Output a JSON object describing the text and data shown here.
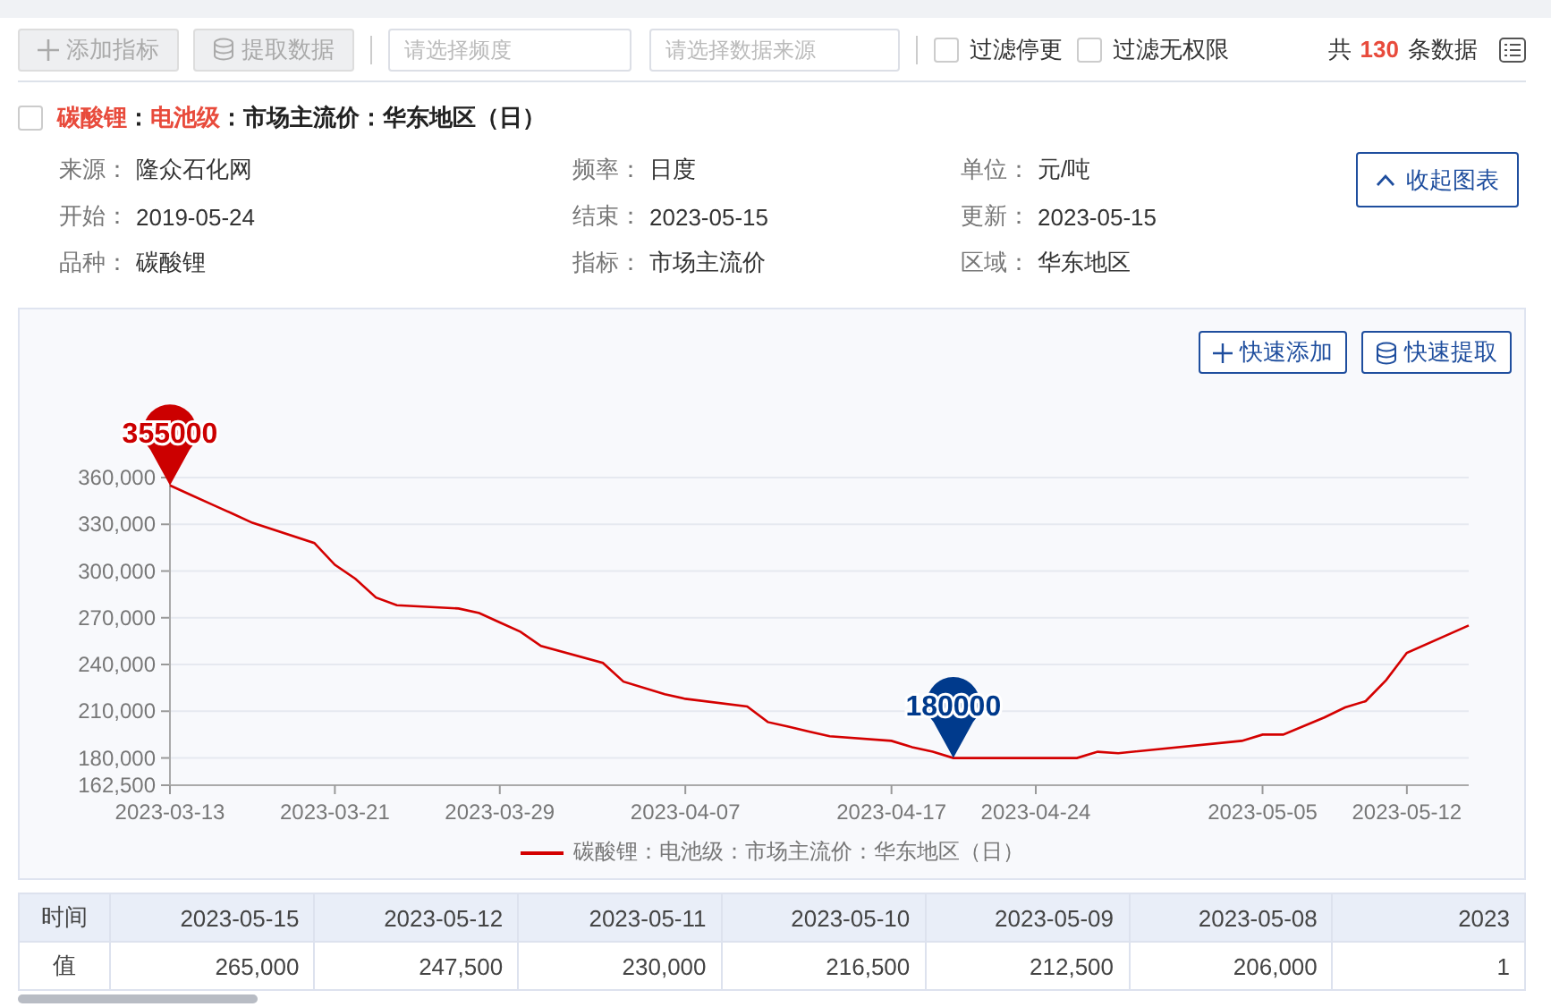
{
  "toolbar": {
    "buttons": [
      {
        "kind": "add",
        "label": "添加指标",
        "disabled": true
      },
      {
        "kind": "extract",
        "label": "提取数据",
        "disabled": true
      }
    ],
    "selects": [
      {
        "placeholder": "请选择频度"
      },
      {
        "placeholder": "请选择数据来源"
      }
    ],
    "filters": [
      {
        "label": "过滤停更",
        "checked": false
      },
      {
        "label": "过滤无权限",
        "checked": false
      }
    ],
    "count": {
      "prefix": "共",
      "value": "130",
      "suffix": "条数据"
    }
  },
  "indicator": {
    "checked": false,
    "title_parts": [
      {
        "text": "碳酸锂",
        "highlight": true
      },
      {
        "text": "：",
        "highlight": false
      },
      {
        "text": "电池级",
        "highlight": true
      },
      {
        "text": "：市场主流价：华东地区（日）",
        "highlight": false
      }
    ],
    "info": [
      {
        "label": "来源：",
        "value": "隆众石化网"
      },
      {
        "label": "频率：",
        "value": "日度"
      },
      {
        "label": "单位：",
        "value": "元/吨"
      },
      {
        "label": "开始：",
        "value": "2019-05-24"
      },
      {
        "label": "结束：",
        "value": "2023-05-15"
      },
      {
        "label": "更新：",
        "value": "2023-05-15"
      },
      {
        "label": "品种：",
        "value": "碳酸锂"
      },
      {
        "label": "指标：",
        "value": "市场主流价"
      },
      {
        "label": "区域：",
        "value": "华东地区"
      }
    ],
    "collapse_button": "收起图表"
  },
  "chart": {
    "buttons": [
      {
        "kind": "add",
        "label": "快速添加"
      },
      {
        "kind": "extract",
        "label": "快速提取"
      }
    ],
    "chart_data": {
      "type": "line",
      "x": [
        "2023-03-13",
        "2023-03-14",
        "2023-03-15",
        "2023-03-16",
        "2023-03-17",
        "2023-03-20",
        "2023-03-21",
        "2023-03-22",
        "2023-03-23",
        "2023-03-24",
        "2023-03-27",
        "2023-03-28",
        "2023-03-29",
        "2023-03-30",
        "2023-03-31",
        "2023-04-03",
        "2023-04-04",
        "2023-04-06",
        "2023-04-07",
        "2023-04-10",
        "2023-04-11",
        "2023-04-12",
        "2023-04-13",
        "2023-04-14",
        "2023-04-17",
        "2023-04-18",
        "2023-04-19",
        "2023-04-20",
        "2023-04-21",
        "2023-04-23",
        "2023-04-24",
        "2023-04-25",
        "2023-04-26",
        "2023-04-27",
        "2023-04-28",
        "2023-05-04",
        "2023-05-05",
        "2023-05-06",
        "2023-05-08",
        "2023-05-09",
        "2023-05-10",
        "2023-05-11",
        "2023-05-12",
        "2023-05-15"
      ],
      "series": [
        {
          "name": "碳酸锂：电池级：市场主流价：华东地区（日）",
          "color": "#d40000",
          "values": [
            355000,
            349000,
            343000,
            337000,
            331000,
            318000,
            304000,
            295000,
            283000,
            278000,
            276000,
            273000,
            267000,
            261000,
            252000,
            241000,
            229000,
            221000,
            218000,
            213000,
            203000,
            200000,
            197000,
            194000,
            191000,
            187000,
            184000,
            180000,
            180000,
            180000,
            180000,
            180000,
            180000,
            184000,
            183000,
            191000,
            195000,
            195000,
            206000,
            212500,
            216500,
            230000,
            247500,
            265000
          ]
        }
      ],
      "xlim": [
        "2023-03-13",
        "2023-05-15"
      ],
      "grid": true,
      "ylim": [
        162500,
        360000
      ],
      "yticks": [
        {
          "value": 162500,
          "label": "162,500"
        },
        {
          "value": 180000,
          "label": "180,000"
        },
        {
          "value": 210000,
          "label": "210,000"
        },
        {
          "value": 240000,
          "label": "240,000"
        },
        {
          "value": 270000,
          "label": "270,000"
        },
        {
          "value": 300000,
          "label": "300,000"
        },
        {
          "value": 330000,
          "label": "330,000"
        },
        {
          "value": 360000,
          "label": "360,000"
        }
      ],
      "xticks": [
        "2023-03-13",
        "2023-03-21",
        "2023-03-29",
        "2023-04-07",
        "2023-04-17",
        "2023-04-24",
        "2023-05-05",
        "2023-05-12"
      ],
      "annotations": [
        {
          "x": "2023-03-13",
          "y": 355000,
          "text": "355000"
        },
        {
          "x": "2023-04-20",
          "y": 180000,
          "text": "180000"
        }
      ]
    }
  },
  "table": {
    "header": [
      "时间",
      "2023-05-15",
      "2023-05-12",
      "2023-05-11",
      "2023-05-10",
      "2023-05-09",
      "2023-05-08",
      "2023"
    ],
    "rows": [
      [
        "值",
        "265,000",
        "247,500",
        "230,000",
        "216,500",
        "212,500",
        "206,000",
        "1"
      ]
    ]
  }
}
